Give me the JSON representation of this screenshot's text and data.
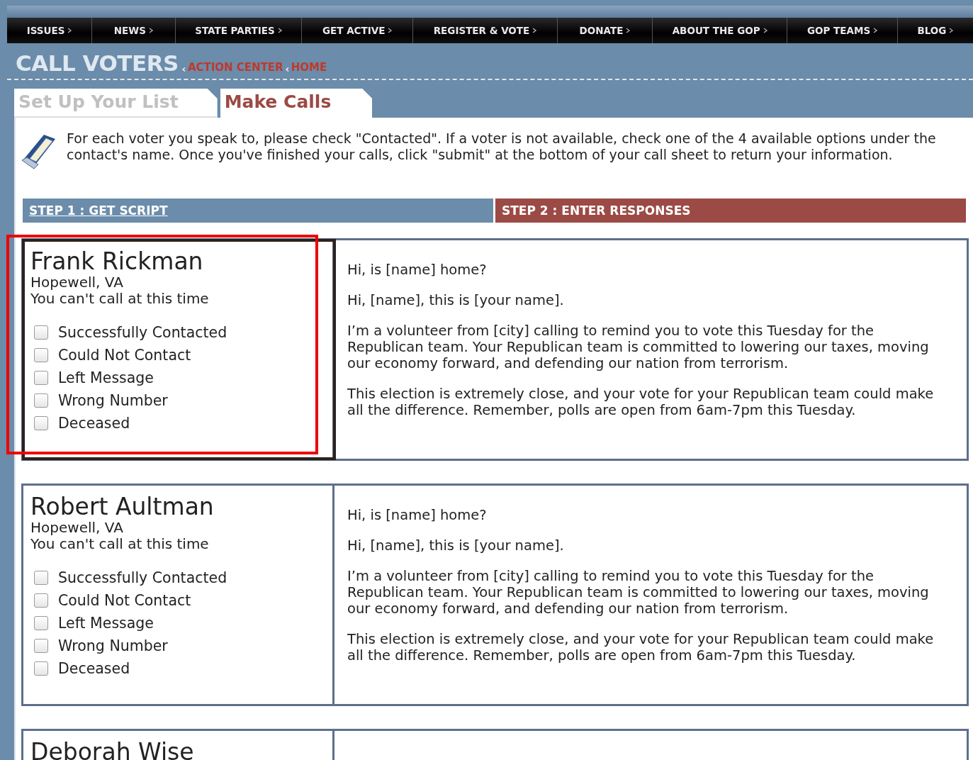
{
  "nav": [
    {
      "label": "ISSUES"
    },
    {
      "label": "NEWS"
    },
    {
      "label": "STATE PARTIES"
    },
    {
      "label": "GET ACTIVE"
    },
    {
      "label": "REGISTER & VOTE"
    },
    {
      "label": "DONATE"
    },
    {
      "label": "ABOUT THE GOP"
    },
    {
      "label": "GOP TEAMS"
    },
    {
      "label": "BLOG"
    }
  ],
  "page_title": "CALL VOTERS",
  "breadcrumb": [
    {
      "label": "ACTION CENTER"
    },
    {
      "label": "HOME"
    }
  ],
  "tabs": [
    {
      "label": "Set Up Your List",
      "selected": false
    },
    {
      "label": "Make Calls",
      "selected": true
    }
  ],
  "instructions": "For each voter you speak to, please check \"Contacted\". If a voter is not available, check one of the 4 available options under the contact's name. Once you've finished your calls, click \"submit\" at the bottom of your call sheet to return your information.",
  "steps": [
    {
      "label": "STEP 1 : GET SCRIPT",
      "kind": "link"
    },
    {
      "label": "STEP 2 : ENTER RESPONSES",
      "kind": "current"
    }
  ],
  "voters": [
    {
      "name": "Frank Rickman",
      "location": "Hopewell, VA",
      "note": "You can't call at this time",
      "highlighted": true,
      "options": [
        {
          "label": "Successfully Contacted",
          "checked": false
        },
        {
          "label": "Could Not Contact",
          "checked": false
        },
        {
          "label": "Left Message",
          "checked": false
        },
        {
          "label": "Wrong Number",
          "checked": false
        },
        {
          "label": "Deceased",
          "checked": false
        }
      ],
      "script": [
        "Hi, is [name] home?",
        "Hi, [name], this is [your name].",
        "I’m a volunteer from [city] calling to remind you to vote this Tuesday for the Republican team. Your Republican team is committed to lowering our taxes, moving our economy forward, and defending our nation from terrorism.",
        "This election is extremely close, and your vote for your Republican team could make all the difference. Remember, polls are open from 6am-7pm this Tuesday."
      ]
    },
    {
      "name": "Robert Aultman",
      "location": "Hopewell, VA",
      "note": "You can't call at this time",
      "highlighted": false,
      "options": [
        {
          "label": "Successfully Contacted",
          "checked": false
        },
        {
          "label": "Could Not Contact",
          "checked": false
        },
        {
          "label": "Left Message",
          "checked": false
        },
        {
          "label": "Wrong Number",
          "checked": false
        },
        {
          "label": "Deceased",
          "checked": false
        }
      ],
      "script": [
        "Hi, is [name] home?",
        "Hi, [name], this is [your name].",
        "I’m a volunteer from [city] calling to remind you to vote this Tuesday for the Republican team. Your Republican team is committed to lowering our taxes, moving our economy forward, and defending our nation from terrorism.",
        "This election is extremely close, and your vote for your Republican team could make all the difference. Remember, polls are open from 6am-7pm this Tuesday."
      ]
    },
    {
      "name": "Deborah Wise",
      "highlighted": false
    }
  ]
}
